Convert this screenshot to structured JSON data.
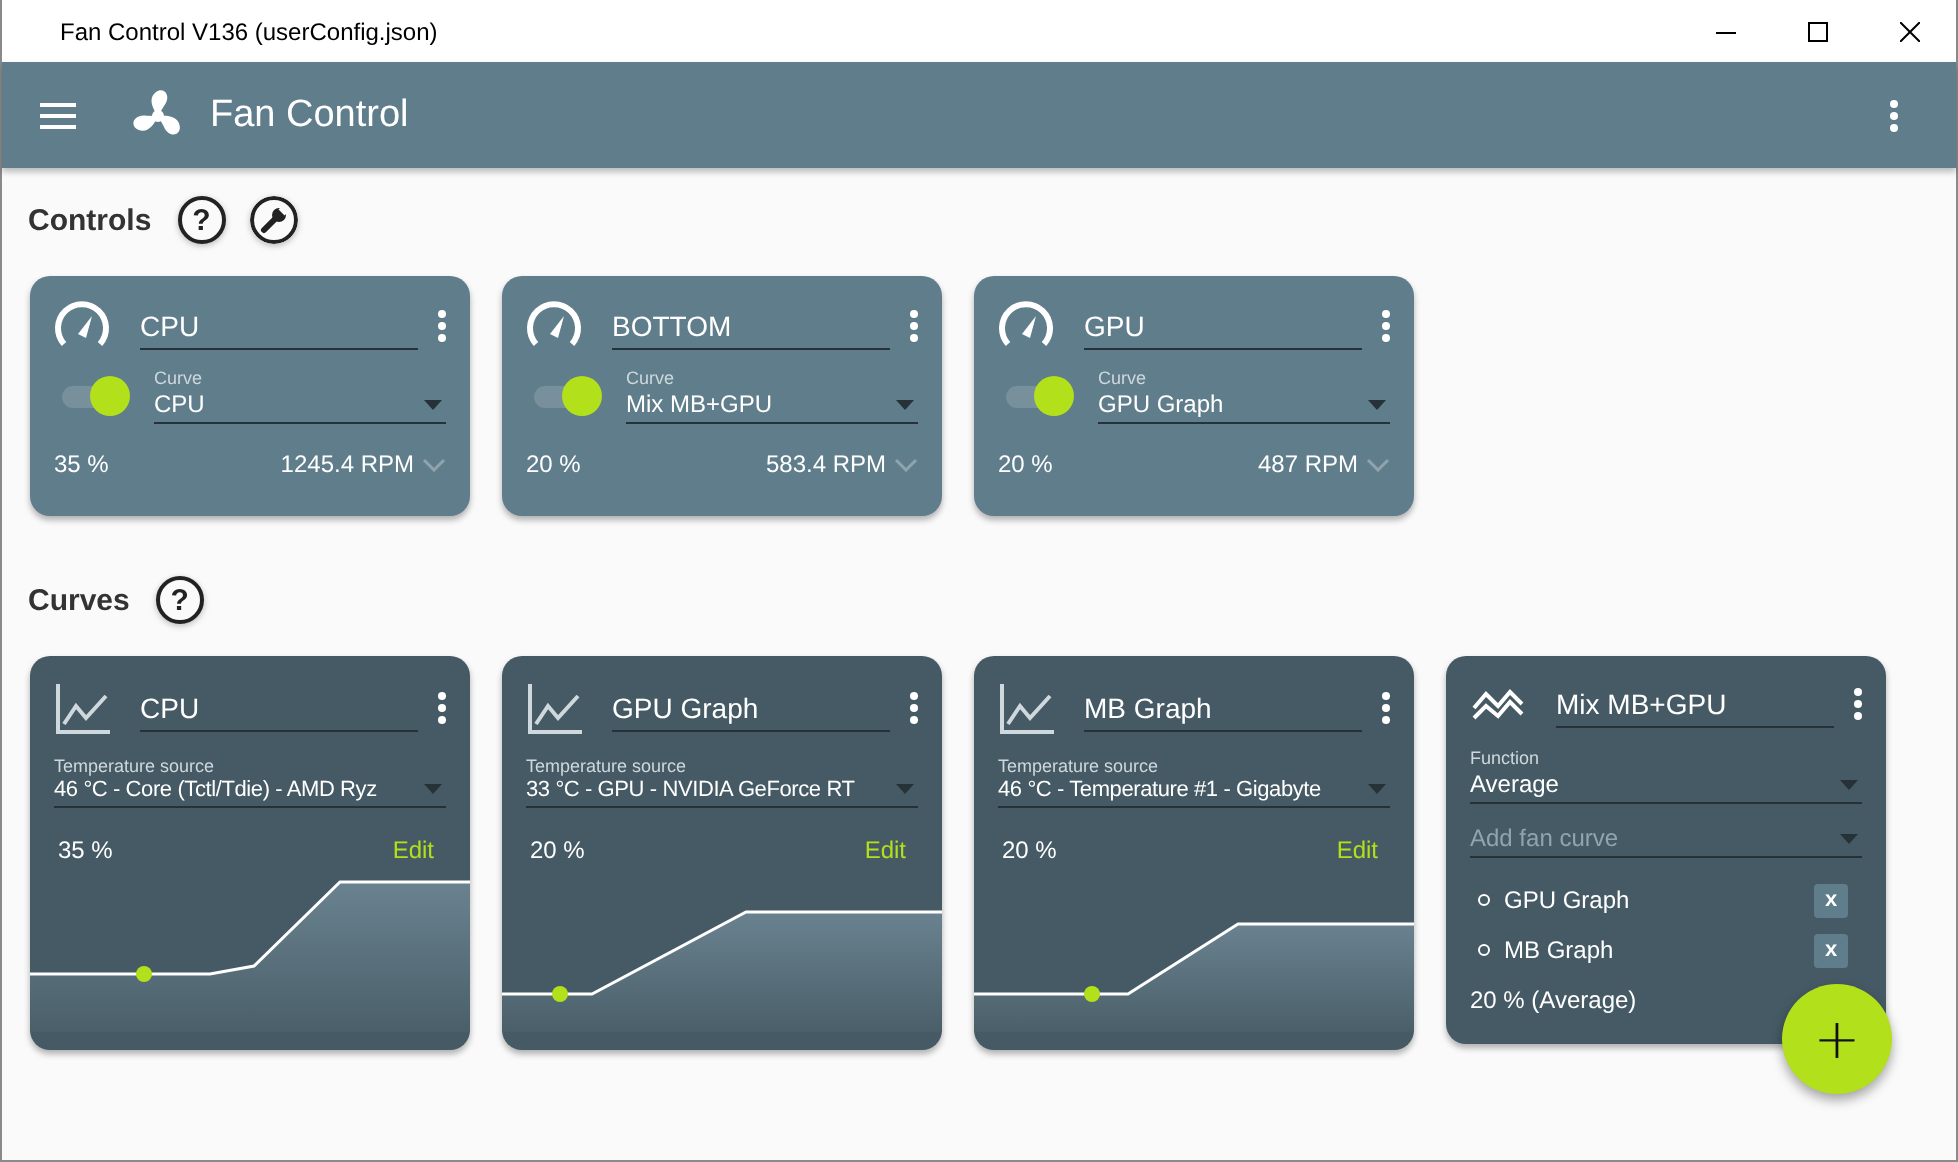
{
  "window": {
    "title": "Fan Control V136 (userConfig.json)"
  },
  "app_bar": {
    "title": "Fan Control"
  },
  "controls": {
    "heading": "Controls",
    "help": "?",
    "items": [
      {
        "name": "CPU",
        "on": true,
        "curve_label": "Curve",
        "curve": "CPU",
        "percent": "35 %",
        "rpm": "1245.4 RPM"
      },
      {
        "name": "BOTTOM",
        "on": true,
        "curve_label": "Curve",
        "curve": "Mix MB+GPU",
        "percent": "20 %",
        "rpm": "583.4 RPM"
      },
      {
        "name": "GPU",
        "on": true,
        "curve_label": "Curve",
        "curve": "GPU Graph",
        "percent": "20 %",
        "rpm": "487 RPM"
      }
    ]
  },
  "curves": {
    "heading": "Curves",
    "help": "?",
    "items": [
      {
        "kind": "graph",
        "name": "CPU",
        "source_label": "Temperature source",
        "source": "46 °C - Core (Tctl/Tdie) - AMD Ryz",
        "percent": "35 %",
        "edit": "Edit"
      },
      {
        "kind": "graph",
        "name": "GPU Graph",
        "source_label": "Temperature source",
        "source": "33 °C - GPU - NVIDIA GeForce RT",
        "percent": "20 %",
        "edit": "Edit"
      },
      {
        "kind": "graph",
        "name": "MB Graph",
        "source_label": "Temperature source",
        "source": "46 °C - Temperature #1 - Gigabyte",
        "percent": "20 %",
        "edit": "Edit"
      },
      {
        "kind": "mix",
        "name": "Mix MB+GPU",
        "function_label": "Function",
        "function": "Average",
        "add_placeholder": "Add fan curve",
        "members": [
          {
            "name": "GPU Graph",
            "remove": "x"
          },
          {
            "name": "MB Graph",
            "remove": "x"
          }
        ],
        "result": "20 % (Average)"
      }
    ]
  },
  "fab": {
    "label": "+"
  }
}
